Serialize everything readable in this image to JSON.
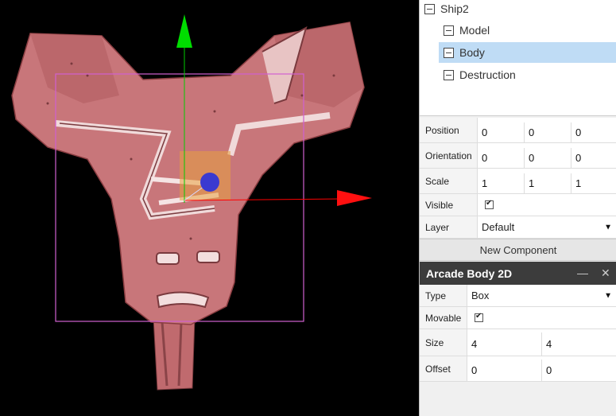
{
  "hierarchy": {
    "items": [
      {
        "label": "Ship2"
      },
      {
        "label": "Model"
      },
      {
        "label": "Body"
      },
      {
        "label": "Destruction"
      }
    ]
  },
  "transform": {
    "position": {
      "label": "Position",
      "values": [
        "0",
        "0",
        "0"
      ]
    },
    "orientation": {
      "label": "Orientation",
      "values": [
        "0",
        "0",
        "0"
      ]
    },
    "scale": {
      "label": "Scale",
      "values": [
        "1",
        "1",
        "1"
      ]
    },
    "visible": {
      "label": "Visible",
      "checked": true
    },
    "layer": {
      "label": "Layer",
      "value": "Default"
    }
  },
  "new_component_label": "New Component",
  "component": {
    "title": "Arcade Body 2D",
    "minimize_glyph": "—",
    "close_glyph": "✕",
    "type": {
      "label": "Type",
      "value": "Box"
    },
    "movable": {
      "label": "Movable",
      "checked": true
    },
    "size": {
      "label": "Size",
      "values": [
        "4",
        "4"
      ]
    },
    "offset": {
      "label": "Offset",
      "values": [
        "0",
        "0"
      ]
    }
  },
  "gizmo": {
    "x_axis_color": "#ff0000",
    "y_axis_color": "#00cc00",
    "z_handle_color": "#3a3ad0",
    "bounds_color": "#d060d0"
  }
}
